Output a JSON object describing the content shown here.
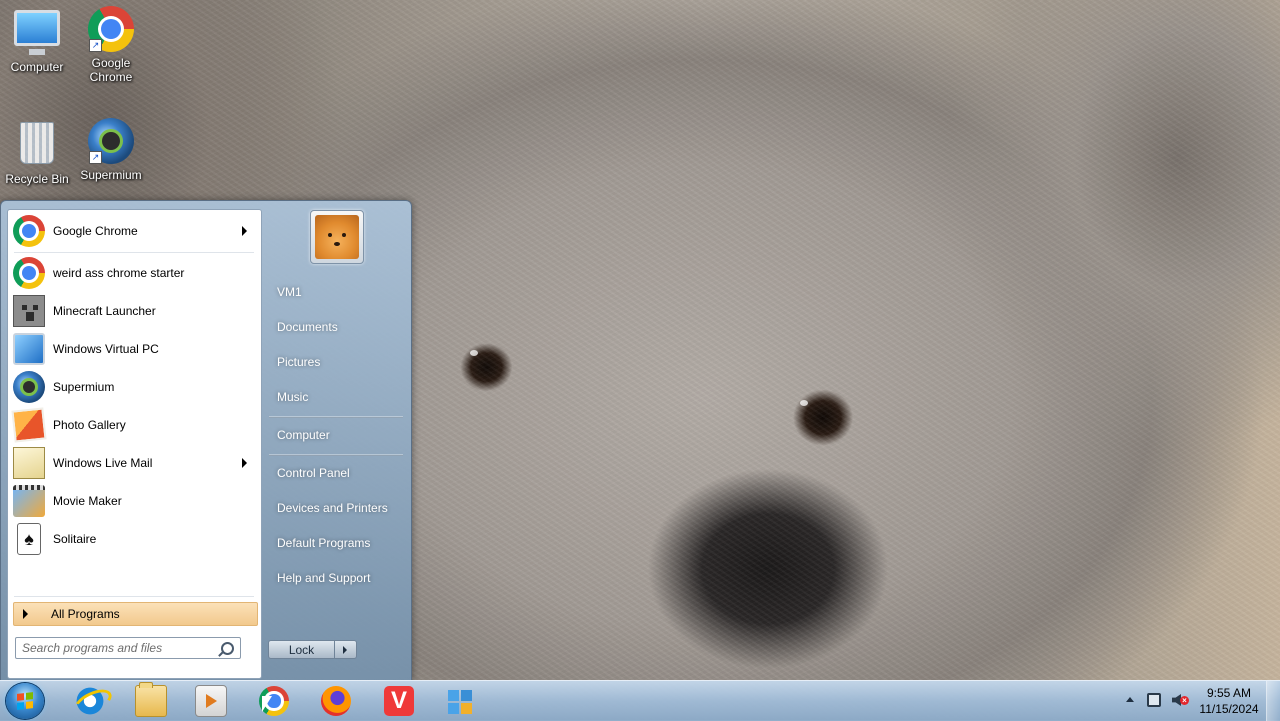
{
  "desktop": {
    "icons": [
      {
        "label_line1": "Computer",
        "label_line2": "",
        "icon": "computer-icon"
      },
      {
        "label_line1": "Google",
        "label_line2": "Chrome",
        "icon": "chrome-icon"
      },
      {
        "label_line1": "Recycle Bin",
        "label_line2": "",
        "icon": "recycle-bin-icon"
      },
      {
        "label_line1": "Supermium",
        "label_line2": "",
        "icon": "supermium-icon"
      }
    ]
  },
  "start_menu": {
    "programs": [
      {
        "label": "Google Chrome",
        "icon": "chrome-icon",
        "has_submenu": true
      },
      {
        "label": "weird ass chrome starter",
        "icon": "chrome-icon",
        "has_submenu": false
      },
      {
        "label": "Minecraft Launcher",
        "icon": "minecraft-icon",
        "has_submenu": false
      },
      {
        "label": "Windows Virtual PC",
        "icon": "virtual-pc-icon",
        "has_submenu": false
      },
      {
        "label": "Supermium",
        "icon": "supermium-icon",
        "has_submenu": false
      },
      {
        "label": "Photo Gallery",
        "icon": "photo-gallery-icon",
        "has_submenu": false
      },
      {
        "label": "Windows Live Mail",
        "icon": "live-mail-icon",
        "has_submenu": true
      },
      {
        "label": "Movie Maker",
        "icon": "movie-maker-icon",
        "has_submenu": false
      },
      {
        "label": "Solitaire",
        "icon": "solitaire-icon",
        "has_submenu": false
      }
    ],
    "all_programs_label": "All Programs",
    "search": {
      "placeholder": "Search programs and files"
    },
    "right_links": [
      {
        "label": "VM1"
      },
      {
        "label": "Documents"
      },
      {
        "label": "Pictures"
      },
      {
        "label": "Music"
      },
      {
        "label": "Computer"
      },
      {
        "label": "Control Panel"
      },
      {
        "label": "Devices and Printers"
      },
      {
        "label": "Default Programs"
      },
      {
        "label": "Help and Support"
      }
    ],
    "lock_label": "Lock"
  },
  "taskbar": {
    "pinned": [
      {
        "icon": "internet-explorer-icon"
      },
      {
        "icon": "file-explorer-icon"
      },
      {
        "icon": "media-player-icon"
      },
      {
        "icon": "chrome-icon"
      },
      {
        "icon": "firefox-icon"
      },
      {
        "icon": "vivaldi-icon"
      },
      {
        "icon": "windows-update-icon"
      }
    ],
    "clock": {
      "time": "9:55 AM",
      "date": "11/15/2024"
    }
  }
}
